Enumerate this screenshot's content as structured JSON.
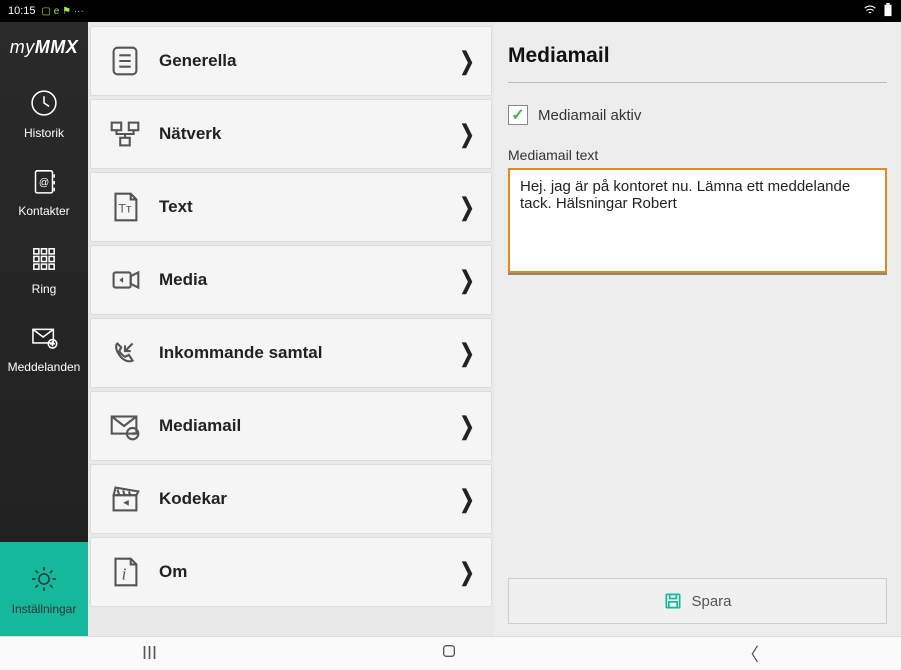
{
  "status": {
    "time": "10:15",
    "indicators": "⬚ ℮ ⚑ ···"
  },
  "logo": "myMMX",
  "sidebar": {
    "items": [
      {
        "label": "Historik"
      },
      {
        "label": "Kontakter"
      },
      {
        "label": "Ring"
      },
      {
        "label": "Meddelanden"
      },
      {
        "label": "Inställningar"
      }
    ]
  },
  "settings": {
    "items": [
      {
        "label": "Generella"
      },
      {
        "label": "Nätverk"
      },
      {
        "label": "Text"
      },
      {
        "label": "Media"
      },
      {
        "label": "Inkommande samtal"
      },
      {
        "label": "Mediamail"
      },
      {
        "label": "Kodekar"
      },
      {
        "label": "Om"
      }
    ],
    "chevron": "❭"
  },
  "detail": {
    "title": "Mediamail",
    "checkbox_label": "Mediamail aktiv",
    "checkbox_checked": "✓",
    "field_label": "Mediamail text",
    "text_value": "Hej. jag är på kontoret nu. Lämna ett meddelande tack. Hälsningar Robert",
    "save_label": "Spara"
  }
}
